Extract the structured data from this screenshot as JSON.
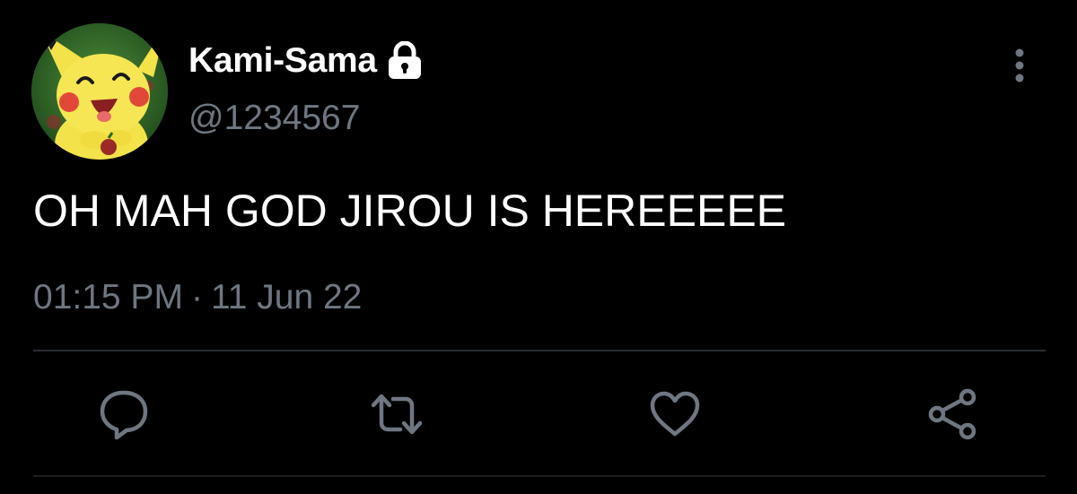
{
  "tweet": {
    "author": {
      "display_name": "Kami-Sama",
      "handle": "@1234567",
      "protected_icon": "lock-icon",
      "avatar": "pikachu-avatar"
    },
    "text": "OH MAH GOD JIROU IS HEREEEEE",
    "time": "01:15 PM",
    "separator": "·",
    "date": "11 Jun 22",
    "actions": [
      {
        "name": "reply",
        "icon": "speech-bubble-icon"
      },
      {
        "name": "retweet",
        "icon": "retweet-icon"
      },
      {
        "name": "like",
        "icon": "heart-icon"
      },
      {
        "name": "share",
        "icon": "share-icon"
      }
    ],
    "menu_icon": "more-vertical-icon"
  },
  "colors": {
    "background": "#000000",
    "primary_text": "#ffffff",
    "secondary_text": "#6e7781",
    "icon": "#6e7781",
    "divider": "#2a2d31"
  }
}
